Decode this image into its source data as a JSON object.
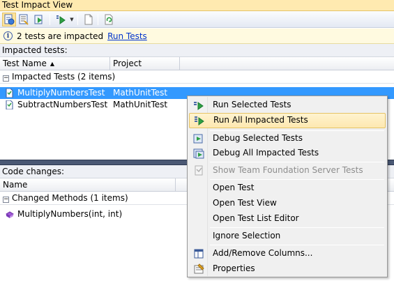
{
  "window": {
    "title": "Test Impact View"
  },
  "info": {
    "message": "2 tests are impacted",
    "link": "Run Tests"
  },
  "impacted": {
    "section_label": "Impacted tests:",
    "columns": [
      "Test Name",
      "Project"
    ],
    "group_label": "Impacted Tests (2 items)",
    "rows": [
      {
        "name": "MultiplyNumbersTest",
        "project": "MathUnitTest",
        "selected": true
      },
      {
        "name": "SubtractNumbersTest",
        "project": "MathUnitTest",
        "selected": false
      }
    ]
  },
  "changes": {
    "section_label": "Code changes:",
    "columns": [
      "Name"
    ],
    "group_label": "Changed Methods (1 items)",
    "rows": [
      {
        "name": "MultiplyNumbers(int, int)"
      }
    ]
  },
  "context_menu": {
    "items": [
      {
        "label": "Run Selected Tests",
        "icon": "run-selected-icon"
      },
      {
        "label": "Run All Impacted Tests",
        "icon": "run-all-icon",
        "highlighted": true
      },
      {
        "label": "Debug Selected Tests",
        "icon": "debug-selected-icon"
      },
      {
        "label": "Debug All Impacted Tests",
        "icon": "debug-all-icon"
      },
      {
        "label": "Show Team Foundation Server Tests",
        "icon": "tfs-tests-icon",
        "disabled": true
      },
      {
        "label": "Open Test"
      },
      {
        "label": "Open Test View"
      },
      {
        "label": "Open Test List Editor"
      },
      {
        "label": "Ignore Selection"
      },
      {
        "label": "Add/Remove Columns...",
        "icon": "columns-icon"
      },
      {
        "label": "Properties",
        "icon": "properties-icon"
      }
    ]
  },
  "colors": {
    "selection": "#3399ff",
    "title_bar": "#ffeab0",
    "link": "#0033cc",
    "splitter": "#4a5874"
  }
}
